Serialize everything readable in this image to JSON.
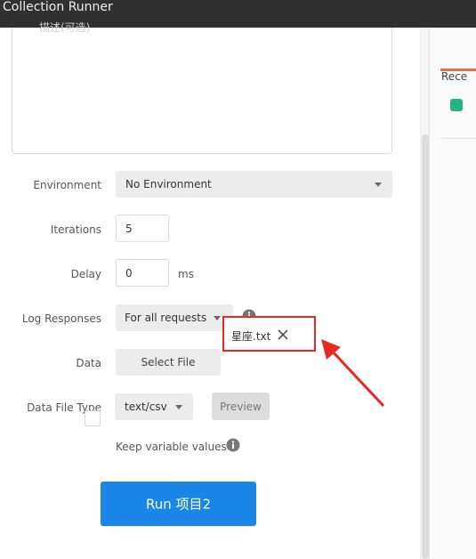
{
  "window": {
    "title": "Collection Runner"
  },
  "description": {
    "placeholder": "描述(可选)"
  },
  "form": {
    "environment": {
      "label": "Environment",
      "value": "No Environment"
    },
    "iterations": {
      "label": "Iterations",
      "value": "5"
    },
    "delay": {
      "label": "Delay",
      "value": "0",
      "unit": "ms"
    },
    "log_responses": {
      "label": "Log Responses",
      "value": "For all requests",
      "icon": "info-icon"
    },
    "data": {
      "label": "Data",
      "button_label": "Select File",
      "file_name": "星座.txt",
      "close_icon": "close-icon"
    },
    "data_file_type": {
      "label": "Data File Type",
      "value": "text/csv",
      "preview_label": "Preview"
    },
    "keep_variable_values": {
      "label": "Keep variable values",
      "checked": false,
      "icon": "info-icon"
    }
  },
  "run_button": {
    "label": "Run 项目2",
    "color": "#1a86e8"
  },
  "annotation": {
    "highlight_color": "#e8291f"
  },
  "right_panel": {
    "tab_label": "Rece",
    "tab_accent": "#f26b3a",
    "status_color": "#26b47f"
  }
}
